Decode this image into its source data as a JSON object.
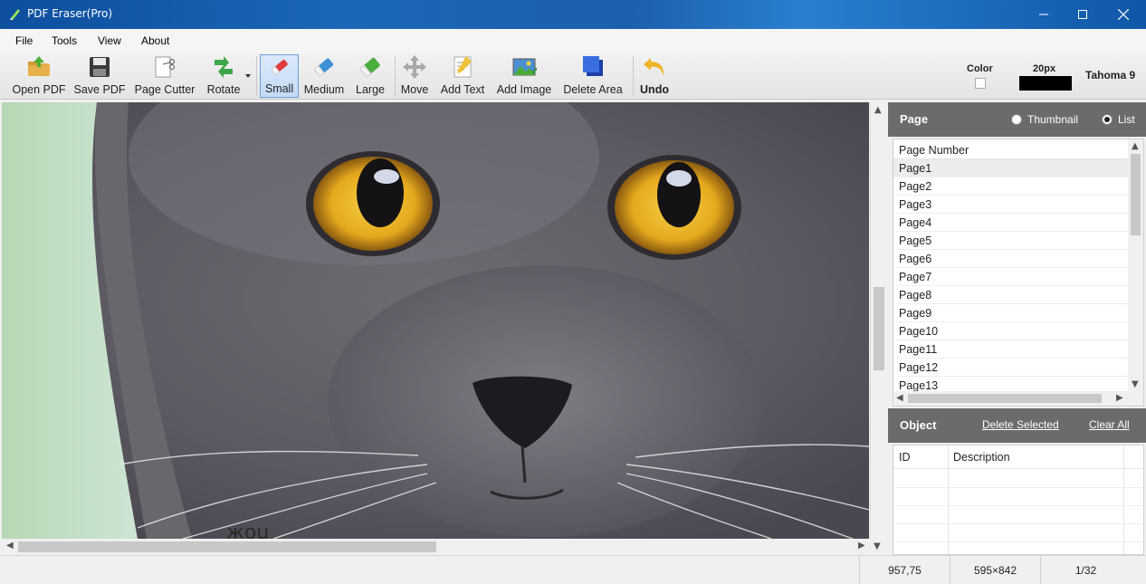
{
  "window": {
    "title": "PDF Eraser(Pro)",
    "minimize": "—",
    "maximize": "☐",
    "close": "✕"
  },
  "menu": [
    "File",
    "Tools",
    "View",
    "About"
  ],
  "toolbar": {
    "open_pdf": "Open PDF",
    "save_pdf": "Save PDF",
    "page_cutter": "Page Cutter",
    "rotate": "Rotate",
    "small": "Small",
    "medium": "Medium",
    "large": "Large",
    "move": "Move",
    "add_text": "Add Text",
    "add_image": "Add Image",
    "delete_area": "Delete Area",
    "undo": "Undo",
    "color_label": "Color",
    "size_label": "20px",
    "font_label": "Tahoma 9"
  },
  "canvas": {
    "partial_text": "жоu"
  },
  "page_panel": {
    "title": "Page",
    "view_thumbnail": "Thumbnail",
    "view_list": "List",
    "selected_view": "List",
    "column": "Page Number",
    "rows": [
      "Page1",
      "Page2",
      "Page3",
      "Page4",
      "Page5",
      "Page6",
      "Page7",
      "Page8",
      "Page9",
      "Page10",
      "Page11",
      "Page12",
      "Page13"
    ]
  },
  "object_panel": {
    "title": "Object",
    "delete_selected": "Delete Selected",
    "clear_all": "Clear All",
    "col_id": "ID",
    "col_description": "Description"
  },
  "status": {
    "coords": "957,75",
    "page_size": "595×842",
    "page_index": "1/32"
  },
  "colors": {
    "title_bar": "#1b66b8",
    "panel_header": "#6b6b6b",
    "active_tool": "#c4dbf6",
    "cat_eye": "#e9b420"
  }
}
